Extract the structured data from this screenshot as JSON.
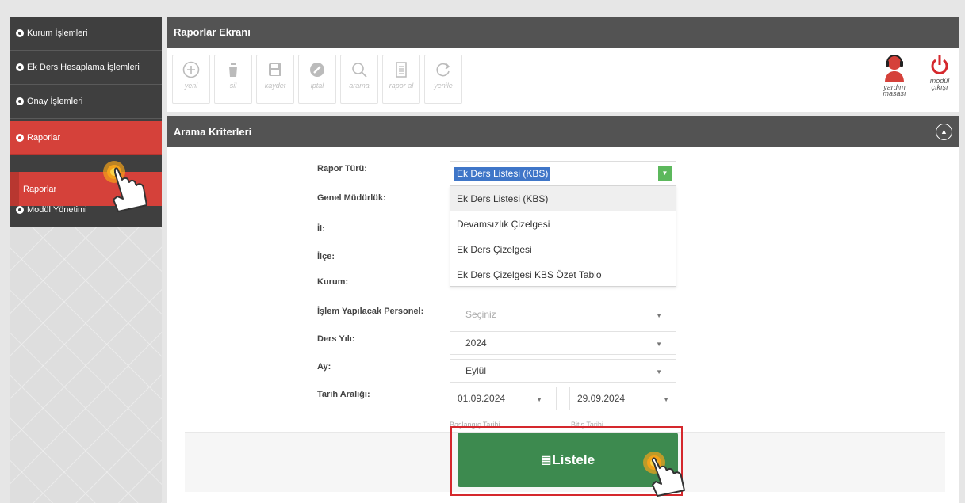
{
  "sidebar": {
    "items": [
      {
        "label": "Kurum İşlemleri"
      },
      {
        "label": "Ek Ders Hesaplama İşlemleri"
      },
      {
        "label": "Onay İşlemleri"
      },
      {
        "label": "Raporlar"
      },
      {
        "label": "Modül Yönetimi"
      }
    ],
    "subitem": {
      "label": "Raporlar"
    }
  },
  "header": {
    "title": "Raporlar Ekranı"
  },
  "toolbar": {
    "buttons": [
      {
        "label": "yeni",
        "icon": "plus-circle-icon"
      },
      {
        "label": "sil",
        "icon": "trash-icon"
      },
      {
        "label": "kaydet",
        "icon": "floppy-icon"
      },
      {
        "label": "iptal",
        "icon": "cancel-icon"
      },
      {
        "label": "arama",
        "icon": "search-icon"
      },
      {
        "label": "rapor al",
        "icon": "document-icon"
      },
      {
        "label": "yenile",
        "icon": "refresh-icon"
      }
    ],
    "help": {
      "line1": "yardım",
      "line2": "masası"
    },
    "exit": {
      "line1": "modül",
      "line2": "çıkışı"
    }
  },
  "search": {
    "title": "Arama Kriterleri",
    "labels": {
      "report_type": "Rapor Türü:",
      "directorate": "Genel Müdürlük:",
      "province": "İl:",
      "district": "İlçe:",
      "institution": "Kurum:",
      "personnel": "İşlem Yapılacak Personel:",
      "year": "Ders Yılı:",
      "month": "Ay:",
      "date_range": "Tarih Aralığı:"
    },
    "report_type_value": "Ek Ders Listesi (KBS)",
    "report_type_options": [
      "Ek Ders Listesi (KBS)",
      "Devamsızlık Çizelgesi",
      "Ek Ders Çizelgesi",
      "Ek Ders Çizelgesi KBS Özet Tablo"
    ],
    "personnel_value": "Seçiniz",
    "year_value": "2024",
    "month_value": "Eylül",
    "start_date": "01.09.2024",
    "end_date": "29.09.2024",
    "start_hint": "Başlangıç Tarihi",
    "end_hint": "Bitiş Tarihi"
  },
  "action": {
    "list_label": "Listele"
  },
  "colors": {
    "accent_red": "#d5413a",
    "list_green": "#3d8a4f",
    "header_gray": "#535353",
    "cursor_orange": "#f4a21a"
  }
}
